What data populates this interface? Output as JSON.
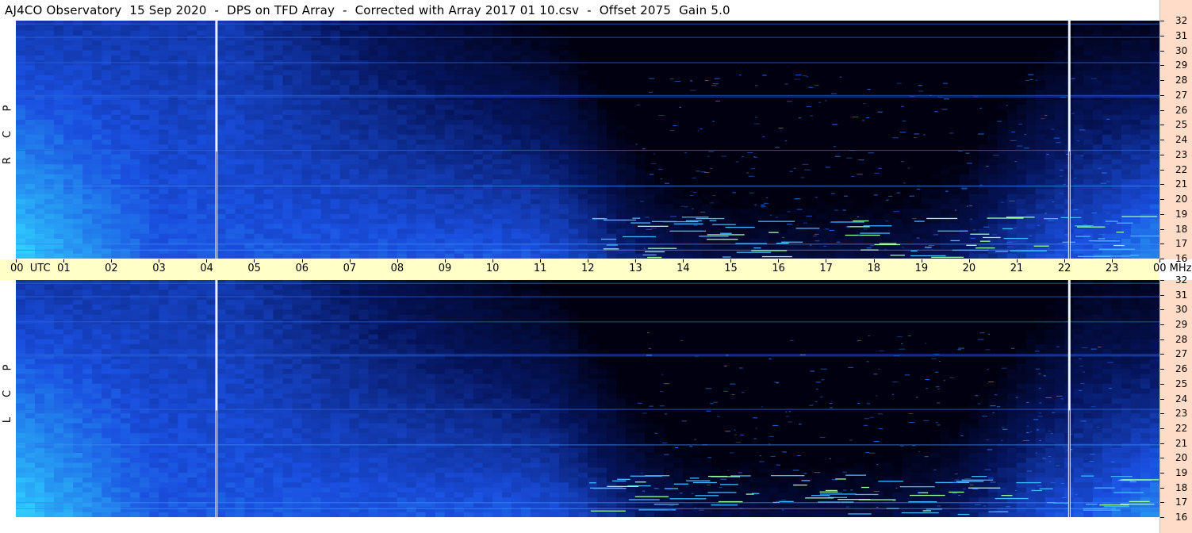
{
  "title": "AJ4CO Observatory  15 Sep 2020  -  DPS on TFD Array  -  Corrected with Array 2017 01 10.csv  -  Offset 2075  Gain 5.0",
  "panels": {
    "top": {
      "letters": [
        "R",
        "C",
        "P"
      ]
    },
    "bottom": {
      "letters": [
        "L",
        "C",
        "P"
      ]
    }
  },
  "colors": {
    "panel_bg": "#061a6e",
    "x_axis_bg": "#ffffc8",
    "y_axis_bg": "#ffdcc8",
    "spectrum_low": "#000018",
    "spectrum_mid": "#1a4fe0",
    "spectrum_high": "#2ecbff",
    "spectrum_peak": "#fff25a"
  },
  "chart_data": [
    {
      "type": "heatmap",
      "name": "RCP",
      "x_unit": "UTC",
      "y_unit": "MHz",
      "x_ticks": [
        "00",
        "01",
        "02",
        "03",
        "04",
        "05",
        "06",
        "07",
        "08",
        "09",
        "10",
        "11",
        "12",
        "13",
        "14",
        "15",
        "16",
        "17",
        "18",
        "19",
        "20",
        "21",
        "22",
        "23",
        "00"
      ],
      "x_first_label": "00  UTC",
      "x_last_label": "00 MHz",
      "y_ticks": [
        32,
        31,
        30,
        29,
        28,
        27,
        26,
        25,
        24,
        23,
        22,
        21,
        20,
        19,
        18,
        17,
        16
      ],
      "ylim": [
        16,
        32
      ],
      "xlim": [
        0,
        24
      ],
      "markers_utc": [
        4.2,
        22.1
      ]
    },
    {
      "type": "heatmap",
      "name": "LCP",
      "x_unit": "UTC",
      "y_unit": "MHz",
      "x_ticks": [
        "00",
        "01",
        "02",
        "03",
        "04",
        "05",
        "06",
        "07",
        "08",
        "09",
        "10",
        "11",
        "12",
        "13",
        "14",
        "15",
        "16",
        "17",
        "18",
        "19",
        "20",
        "21",
        "22",
        "23",
        "00"
      ],
      "y_ticks": [
        32,
        31,
        30,
        29,
        28,
        27,
        26,
        25,
        24,
        23,
        22,
        21,
        20,
        19,
        18,
        17,
        16
      ],
      "ylim": [
        16,
        32
      ],
      "xlim": [
        0,
        24
      ],
      "markers_utc": [
        4.2,
        22.1
      ]
    }
  ]
}
